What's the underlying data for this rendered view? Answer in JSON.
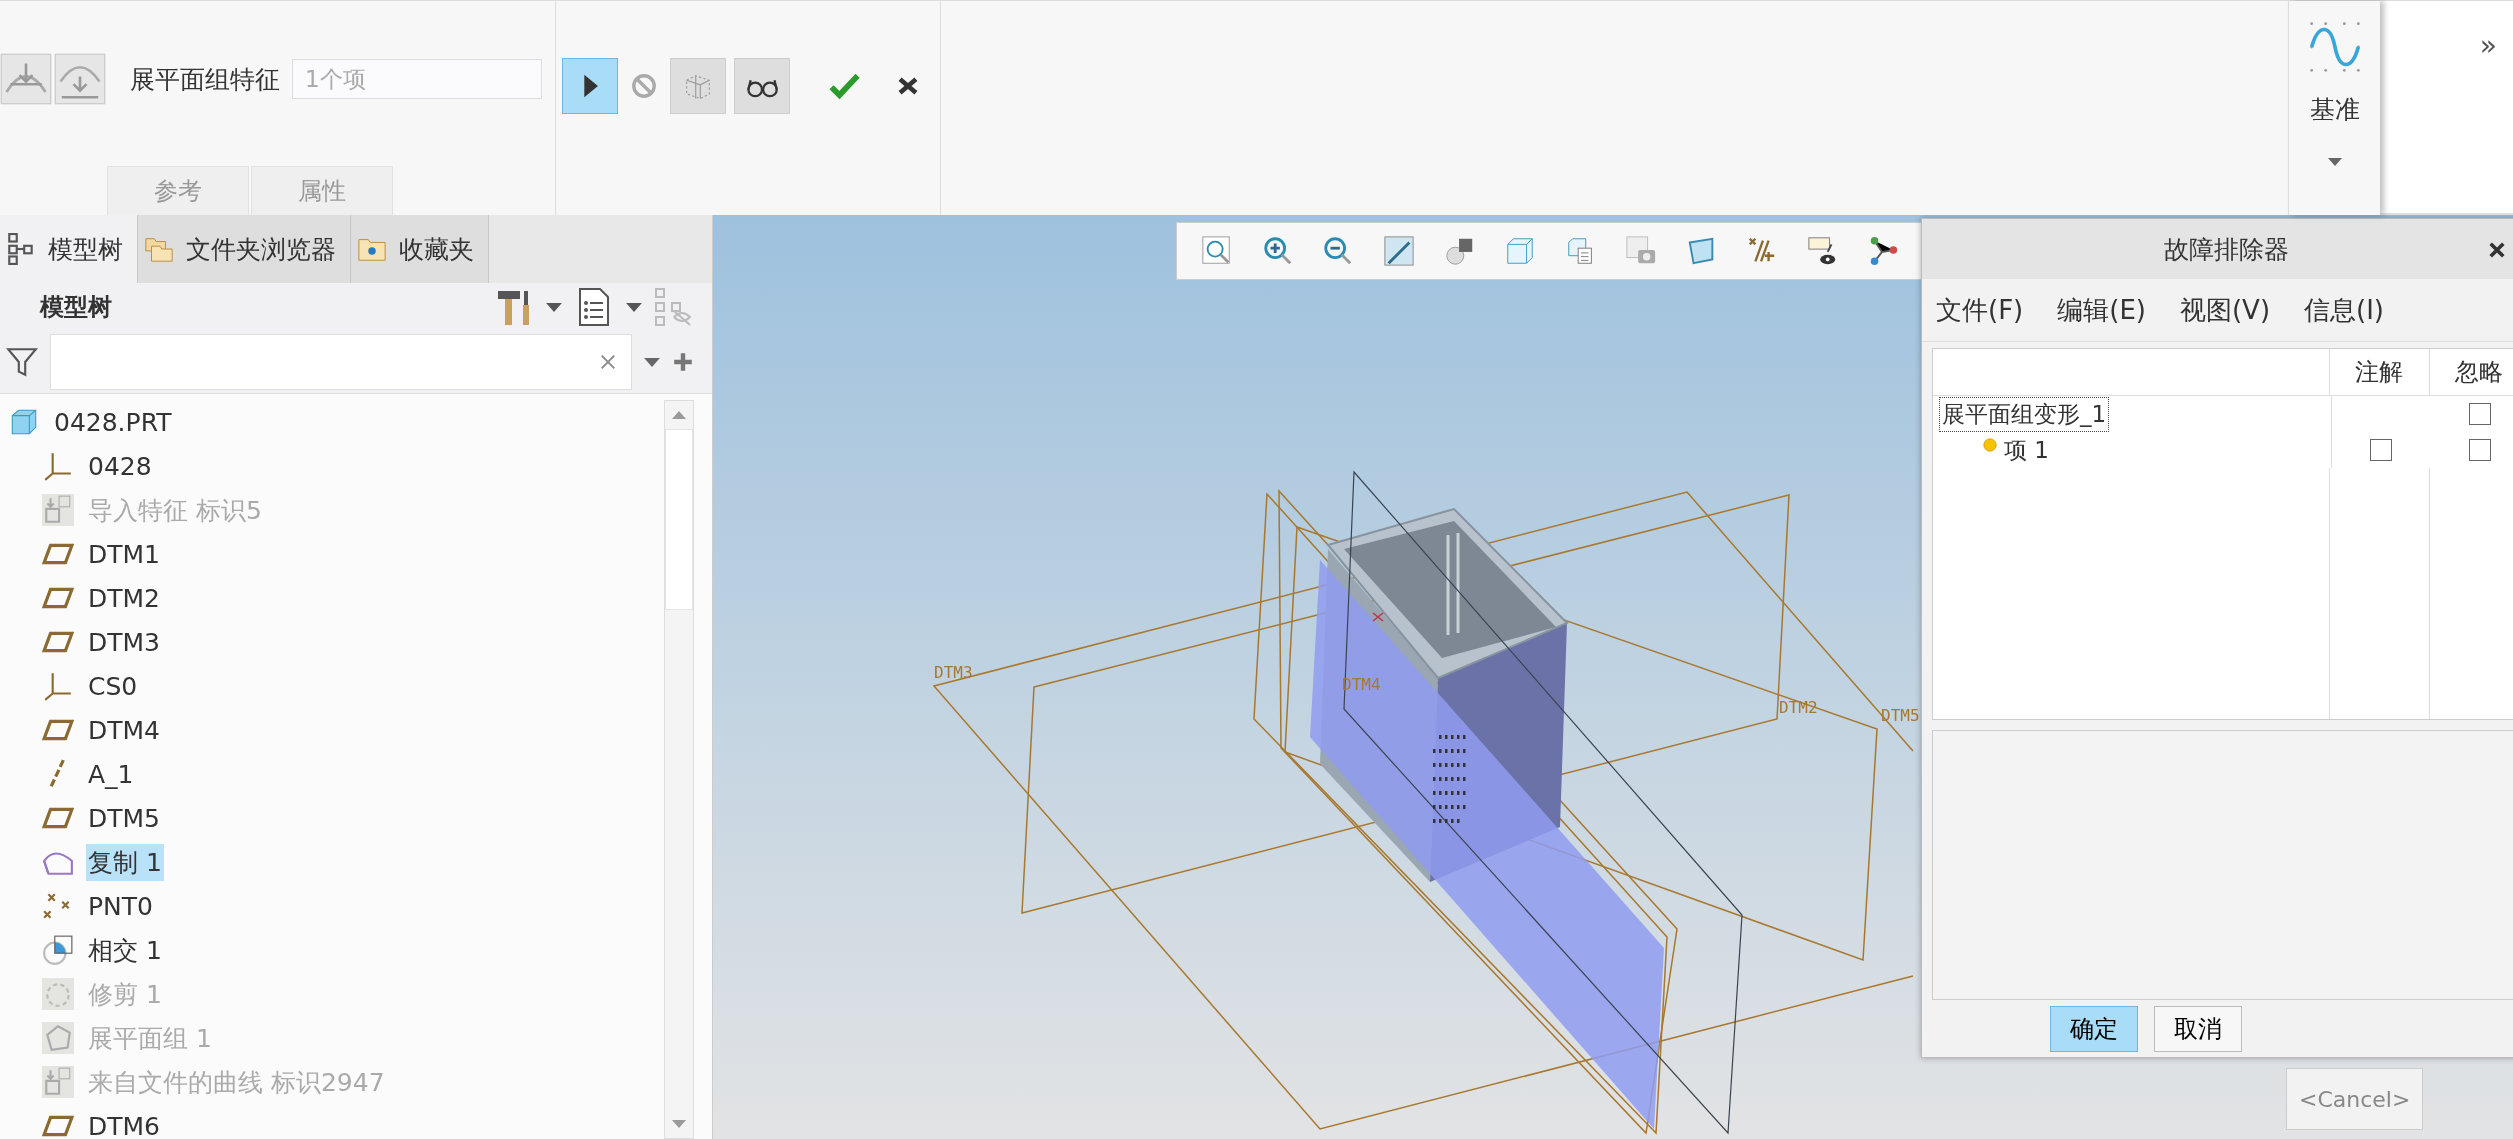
{
  "ribbon": {
    "feature_label": "展平面组特征",
    "feature_field": {
      "placeholder": "1个项"
    },
    "tabs": [
      {
        "label": "参考",
        "selected": false
      },
      {
        "label": "属性",
        "selected": false
      }
    ],
    "controls": [
      {
        "kind": "play",
        "selected": true
      },
      {
        "kind": "stop",
        "selected": false
      },
      {
        "kind": "preview",
        "selected": false
      },
      {
        "kind": "glasses",
        "selected": false
      },
      {
        "kind": "ok",
        "selected": false
      },
      {
        "kind": "cancel",
        "selected": false
      }
    ],
    "datum": {
      "label": "基准"
    },
    "overflow": "»"
  },
  "left_panel": {
    "tabs": [
      {
        "label": "模型树",
        "kind": "tree",
        "selected": true
      },
      {
        "label": "文件夹浏览器",
        "kind": "folders",
        "selected": false
      },
      {
        "label": "收藏夹",
        "kind": "favorites",
        "selected": false
      }
    ],
    "title": "模型树",
    "tree": {
      "label": "0428.PRT",
      "kind": "part",
      "disabled": false,
      "selected": false,
      "children": [
        {
          "label": "0428",
          "kind": "csys",
          "disabled": false,
          "selected": false
        },
        {
          "label": "导入特征 标识5",
          "kind": "import",
          "disabled": true,
          "selected": false
        },
        {
          "label": "DTM1",
          "kind": "plane",
          "disabled": false,
          "selected": false
        },
        {
          "label": "DTM2",
          "kind": "plane",
          "disabled": false,
          "selected": false
        },
        {
          "label": "DTM3",
          "kind": "plane",
          "disabled": false,
          "selected": false
        },
        {
          "label": "CS0",
          "kind": "csys",
          "disabled": false,
          "selected": false
        },
        {
          "label": "DTM4",
          "kind": "plane",
          "disabled": false,
          "selected": false
        },
        {
          "label": "A_1",
          "kind": "axis",
          "disabled": false,
          "selected": false
        },
        {
          "label": "DTM5",
          "kind": "plane",
          "disabled": false,
          "selected": false
        },
        {
          "label": "复制 1",
          "kind": "copy",
          "disabled": false,
          "selected": true
        },
        {
          "label": "PNT0",
          "kind": "point",
          "disabled": false,
          "selected": false
        },
        {
          "label": "相交 1",
          "kind": "intersect",
          "disabled": false,
          "selected": false
        },
        {
          "label": "修剪 1",
          "kind": "trim",
          "disabled": true,
          "selected": false
        },
        {
          "label": "展平面组 1",
          "kind": "flatten",
          "disabled": true,
          "selected": false
        },
        {
          "label": "来自文件的曲线 标识2947",
          "kind": "import",
          "disabled": true,
          "selected": false
        },
        {
          "label": "DTM6",
          "kind": "plane",
          "disabled": false,
          "selected": false
        }
      ]
    }
  },
  "viewport": {
    "datum_labels": [
      {
        "label": "DTM3"
      },
      {
        "label": "DTM4"
      },
      {
        "label": "DTM2"
      },
      {
        "label": "DTM5"
      }
    ]
  },
  "dialog": {
    "title": "故障排除器",
    "menu": [
      "文件(F)",
      "编辑(E)",
      "视图(V)",
      "信息(I)"
    ],
    "columns": [
      "注解",
      "忽略"
    ],
    "rows": [
      {
        "label": "展平面组变形_1",
        "selected": true,
        "note": null,
        "ignore": false,
        "children": [
          {
            "label": "项 1",
            "selected": false,
            "note": false,
            "ignore": false
          }
        ]
      }
    ],
    "buttons": [
      {
        "label": "确定",
        "kind": "primary"
      },
      {
        "label": "取消",
        "kind": "default"
      }
    ]
  },
  "cancel_button": "<Cancel>"
}
